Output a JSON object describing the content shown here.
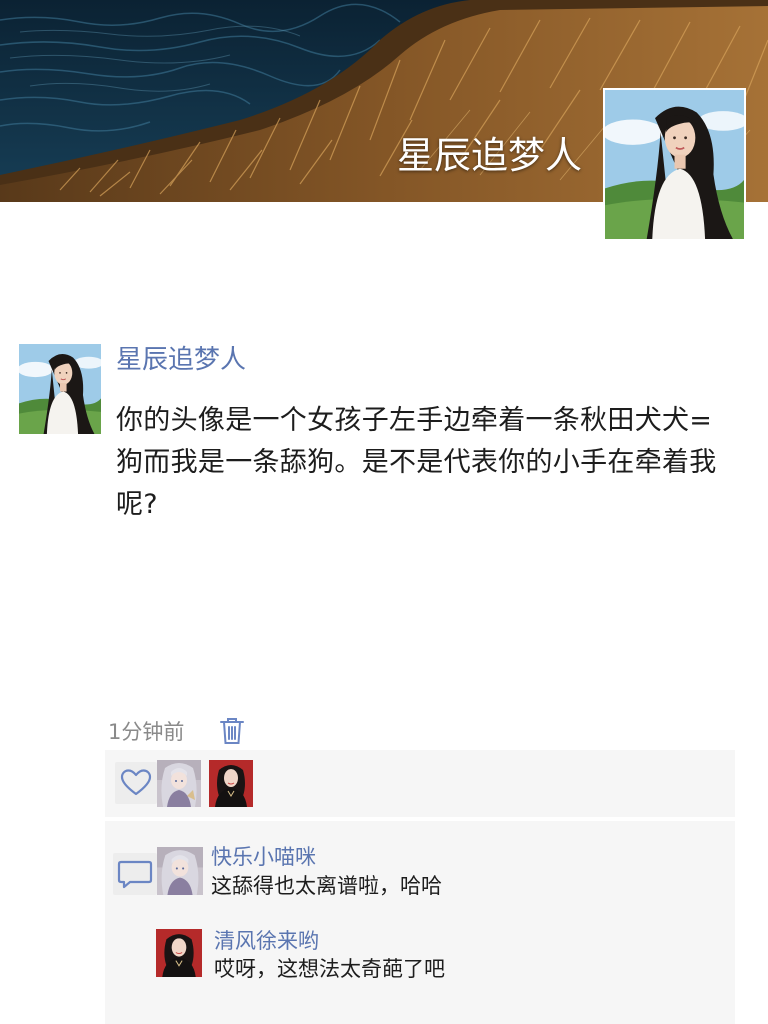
{
  "profile": {
    "name": "星辰追梦人"
  },
  "post": {
    "author": "星辰追梦人",
    "text": "你的头像是一个女孩子左手边牵着一条秋田犬犬=狗而我是一条舔狗。是不是代表你的小手在牵着我呢?",
    "time": "1分钟前"
  },
  "icons": {
    "delete": "trash-icon",
    "like": "heart-outline-icon",
    "comment": "comment-bubble-icon"
  },
  "comments": [
    {
      "author": "快乐小喵咪",
      "text": "这舔得也太离谱啦，哈哈"
    },
    {
      "author": "清风徐来哟",
      "text": "哎呀，这想法太奇葩了吧"
    }
  ],
  "colors": {
    "link": "#5a75b0",
    "icon": "#6b86c4",
    "panel": "#f6f6f6"
  }
}
